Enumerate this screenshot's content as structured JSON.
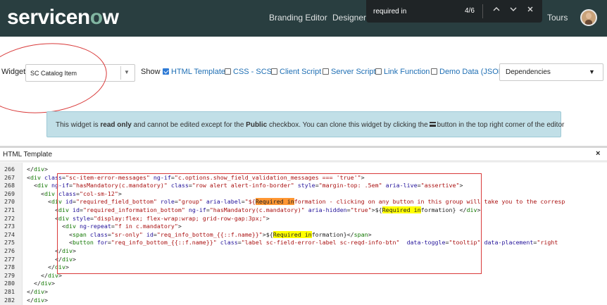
{
  "nav": {
    "logo_prefix": "servicen",
    "logo_o": "o",
    "logo_suffix": "w",
    "branding_editor": "Branding Editor",
    "designer": "Designer ↗",
    "tours": "Tours"
  },
  "find": {
    "query": "required in",
    "count": "4/6",
    "prev_icon": "chevron-up-icon",
    "next_icon": "chevron-down-icon",
    "close_icon": "close-icon"
  },
  "toolbar": {
    "widget_label": "Widget",
    "widget_value": "SC Catalog Item",
    "show_label": "Show",
    "options": [
      {
        "label": "HTML Template",
        "checked": true
      },
      {
        "label": "CSS - SCSS",
        "checked": false
      },
      {
        "label": "Client Script",
        "checked": false
      },
      {
        "label": "Server Script",
        "checked": false
      },
      {
        "label": "Link Function",
        "checked": false
      },
      {
        "label": "Demo Data (JSON)",
        "checked": false
      }
    ],
    "dependencies": "Dependencies"
  },
  "alert": {
    "t1": "This widget is ",
    "b1": "read only",
    "t2": " and cannot be edited except for the ",
    "b2": "Public",
    "t3": " checkbox. You can clone this widget by clicking the",
    "t4": "button in the top right corner of the editor"
  },
  "editor": {
    "title": "HTML Template",
    "close": "×"
  },
  "colors": {
    "nav_bg": "#293e40",
    "accent": "#81b5a1",
    "alert_bg": "#c1dfe7",
    "annotation_red": "#d93a3a",
    "find_highlight": "#ffff00",
    "find_current": "#ff9632"
  }
}
